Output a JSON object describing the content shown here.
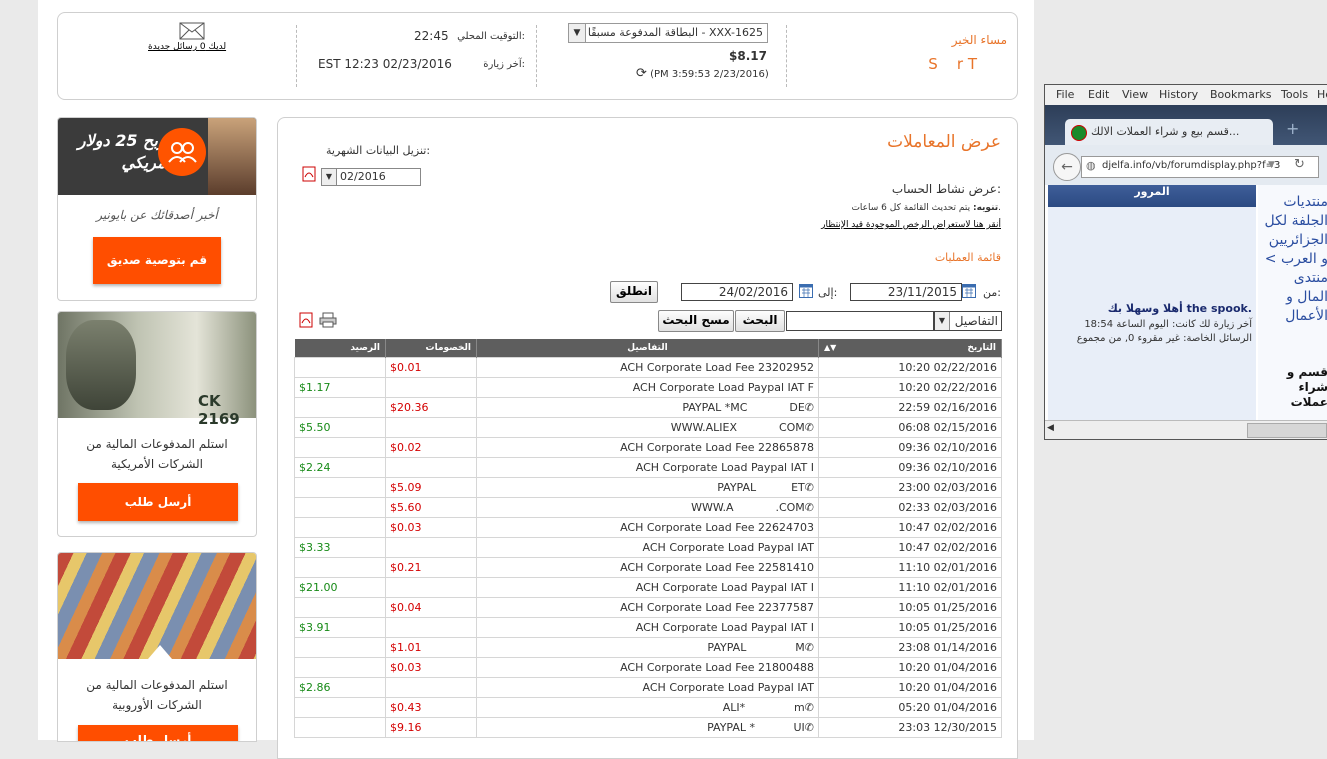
{
  "header": {
    "greeting": "مساء الخير",
    "user_name": "S    r T",
    "card_select": "البطاقة المدفوعة مسبقًا - XXX-1625",
    "balance": "$8.17",
    "balance_time": "(PM 3:59:53 2/23/2016)",
    "local_time_label": "التوقيت المحلي:",
    "local_time_value": "22:45",
    "last_visit_label": "آخر زيارة:",
    "last_visit_value": "EST 12:23 02/23/2016",
    "messages_text": "لديك 0 رسائل جديدة"
  },
  "promos": [
    {
      "banner": "اربح 25 دولار أمريكي",
      "text": "أخبر أصدقائك عن بايونير",
      "button": "قم بتوصية صديق"
    },
    {
      "text": "استلم المدفوعات المالية من الشركات الأمريكية",
      "button": "أرسل طلب",
      "banner_code": "CK 2169"
    },
    {
      "text": "استلم المدفوعات المالية من الشركات الأوروبية",
      "button": "أرسل طلب"
    }
  ],
  "transactions": {
    "title": "عرض المعاملات",
    "monthly_label": "تنزيل البيانات الشهرية:",
    "month_value": "02/2016",
    "activity_label": "عرض نشاط الحساب:",
    "note_bold": "تنويه:",
    "note_text": " يتم تحديث القائمة كل 6 ساعات.",
    "pending_link": "أنقر هنا لاستعراض الرخص الموجودة قيد الإنتظار",
    "ops_title": "قائمة العمليات",
    "from_label": "من:",
    "from_value": "23/11/2015",
    "to_label": "إلى:",
    "to_value": "24/02/2016",
    "go_button": "انطلق",
    "filter_select": "التفاصيل",
    "search_button": "البحث",
    "clear_button": "مسح البحث",
    "columns": {
      "date": "التاريخ",
      "details": "التفاصيل",
      "debits": "الخصومات",
      "balance": "الرصيد"
    },
    "rows": [
      {
        "date": "10:20 02/22/2016",
        "details": "ACH Corporate Load Fee 23202952",
        "debit": "$0.01",
        "credit": ""
      },
      {
        "date": "10:20 02/22/2016",
        "details": "ACH Corporate Load Paypal IAT F",
        "debit": "",
        "credit": "$1.17"
      },
      {
        "date": "22:59 02/16/2016",
        "details": "PAYPAL *MC            DE",
        "debit": "$20.36",
        "credit": "",
        "phone": true
      },
      {
        "date": "06:08 02/15/2016",
        "details": "WWW.ALIEX            COM",
        "debit": "",
        "credit": "$5.50",
        "phone": true
      },
      {
        "date": "09:36 02/10/2016",
        "details": "ACH Corporate Load Fee 22865878",
        "debit": "$0.02",
        "credit": ""
      },
      {
        "date": "09:36 02/10/2016",
        "details": "ACH Corporate Load Paypal IAT I",
        "debit": "",
        "credit": "$2.24"
      },
      {
        "date": "23:00 02/03/2016",
        "details": "PAYPAL          ET",
        "debit": "$5.09",
        "credit": "",
        "phone": true
      },
      {
        "date": "02:33 02/03/2016",
        "details": "WWW.A            .COM",
        "debit": "$5.60",
        "credit": "",
        "phone": true
      },
      {
        "date": "10:47 02/02/2016",
        "details": "ACH Corporate Load Fee 22624703",
        "debit": "$0.03",
        "credit": ""
      },
      {
        "date": "10:47 02/02/2016",
        "details": "ACH Corporate Load Paypal IAT",
        "debit": "",
        "credit": "$3.33"
      },
      {
        "date": "11:10 02/01/2016",
        "details": "ACH Corporate Load Fee 22581410",
        "debit": "$0.21",
        "credit": ""
      },
      {
        "date": "11:10 02/01/2016",
        "details": "ACH Corporate Load Paypal IAT I",
        "debit": "",
        "credit": "$21.00"
      },
      {
        "date": "10:05 01/25/2016",
        "details": "ACH Corporate Load Fee 22377587",
        "debit": "$0.04",
        "credit": ""
      },
      {
        "date": "10:05 01/25/2016",
        "details": "ACH Corporate Load Paypal IAT I",
        "debit": "",
        "credit": "$3.91"
      },
      {
        "date": "23:08 01/14/2016",
        "details": "PAYPAL              M",
        "debit": "$1.01",
        "credit": "",
        "phone": true
      },
      {
        "date": "10:20 01/04/2016",
        "details": "ACH Corporate Load Fee 21800488",
        "debit": "$0.03",
        "credit": ""
      },
      {
        "date": "10:20 01/04/2016",
        "details": "ACH Corporate Load Paypal IAT",
        "debit": "",
        "credit": "$2.86"
      },
      {
        "date": "05:20 01/04/2016",
        "details": "ALI*              m",
        "debit": "$0.43",
        "credit": "",
        "phone": true
      },
      {
        "date": "23:03 12/30/2015",
        "details": "PAYPAL *           UI",
        "debit": "$9.16",
        "credit": "",
        "phone": true
      }
    ]
  },
  "browser": {
    "menu": [
      "File",
      "Edit",
      "View",
      "History",
      "Bookmarks",
      "Tools",
      "He"
    ],
    "tab_title": "قسم بيع و شراء العملات الالك...",
    "url": "djelfa.info/vb/forumdisplay.php?f=3",
    "left_header": "المرور",
    "welcome": "أهلا وسهلا بك the spook.",
    "last_visit": "آخر زيارة لك كانت: اليوم الساعة 18:54",
    "private_msgs": "الرسائل الخاصة: غير مقروء 0, من مجموع",
    "side_text": "منتديات الجلفة لكل الجزائريين و العرب > منتدى المال و الأعمال",
    "side_link": "قسم و شراء عملات"
  }
}
